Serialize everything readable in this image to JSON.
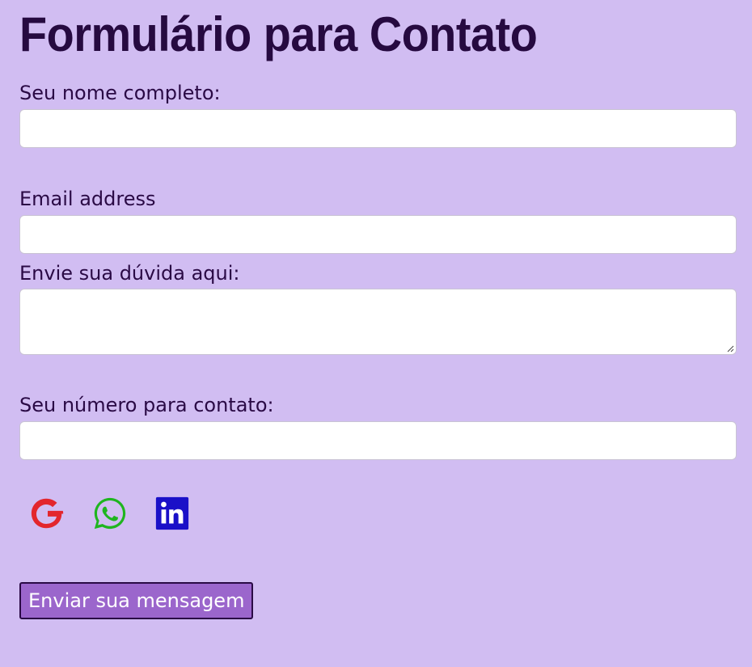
{
  "form": {
    "title": "Formulário para Contato",
    "name_label": "Seu nome completo:",
    "name_value": "",
    "email_label": "Email address",
    "email_value": "",
    "question_label": "Envie sua dúvida aqui:",
    "question_value": "",
    "phone_label": "Seu número para contato:",
    "phone_value": "",
    "submit_label": "Enviar sua mensagem"
  },
  "social": [
    {
      "name": "google-icon",
      "color": "#e3262d"
    },
    {
      "name": "whatsapp-icon",
      "color": "#1fb51f"
    },
    {
      "name": "linkedin-icon",
      "color": "#1a10c8"
    }
  ],
  "colors": {
    "background": "#d1bdf2",
    "text": "#2a0a45",
    "button": "#9b66cc"
  }
}
